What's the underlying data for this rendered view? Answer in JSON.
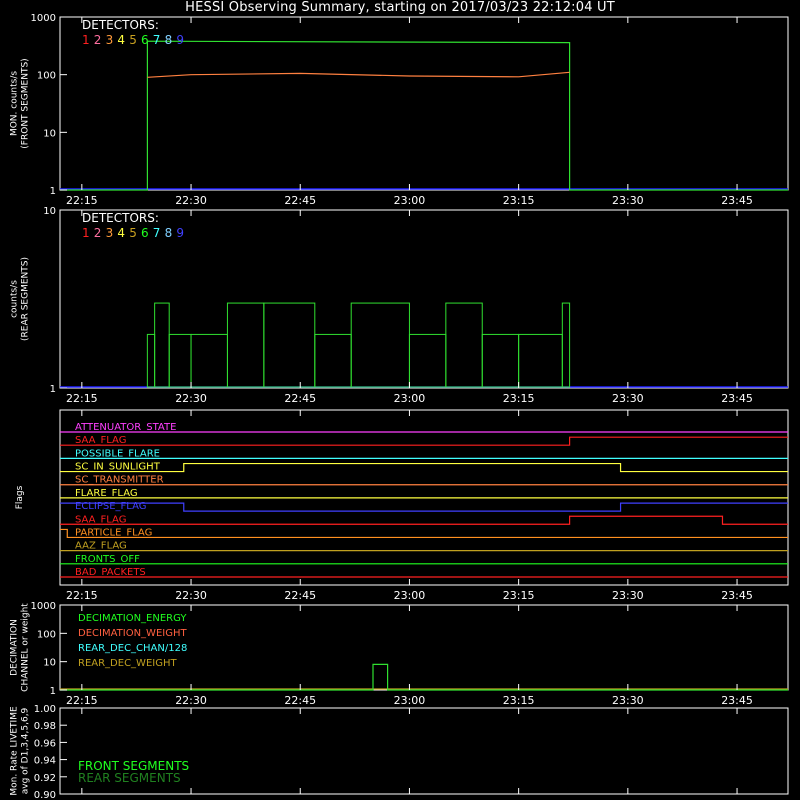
{
  "title": "HESSI Observing Summary, starting on 2017/03/23 22:12:04 UT",
  "colors": {
    "background": "#000000",
    "axis": "#ffffff",
    "det": [
      "#ff2020",
      "#ff6fa0",
      "#ff9a3a",
      "#ffff40",
      "#c8a020",
      "#20ff20",
      "#40ffff",
      "#80d0ff",
      "#4040ff"
    ],
    "front_main": "#30e030",
    "front_secondary": "#ff8040",
    "blue": "#2020ff"
  },
  "time_ticks": [
    "22:15",
    "22:30",
    "22:45",
    "23:00",
    "23:15",
    "23:30",
    "23:45"
  ],
  "chart_data": [
    {
      "id": "front",
      "type": "line",
      "ylabel": [
        "MON. counts/s",
        "(FRONT SEGMENTS)"
      ],
      "yscale": "log",
      "ylim": [
        1,
        1000
      ],
      "yticks": [
        "1",
        "10",
        "100",
        "1000"
      ],
      "legend_title": "DETECTORS:",
      "legend_items": [
        "1",
        "2",
        "3",
        "4",
        "5",
        "6",
        "7",
        "8",
        "9"
      ],
      "series": [
        {
          "color_key": "front_main",
          "x": [
            "22:12",
            "22:24",
            "22:24",
            "23:22",
            "23:22",
            "23:52"
          ],
          "y": [
            1,
            1,
            380,
            360,
            1,
            1
          ]
        },
        {
          "color_key": "front_secondary",
          "x": [
            "22:24",
            "22:30",
            "22:45",
            "23:00",
            "23:15",
            "23:22"
          ],
          "y": [
            90,
            100,
            105,
            95,
            92,
            110
          ]
        }
      ]
    },
    {
      "id": "rear",
      "type": "line",
      "ylabel": [
        "counts/s",
        "(REAR SEGMENTS)"
      ],
      "yscale": "log",
      "ylim": [
        1,
        10
      ],
      "yticks": [
        "1",
        "10"
      ],
      "legend_title": "DETECTORS:",
      "legend_items": [
        "1",
        "2",
        "3",
        "4",
        "5",
        "6",
        "7",
        "8",
        "9"
      ],
      "series": [
        {
          "color_key": "front_main",
          "x": [
            "22:24",
            "22:25",
            "22:27",
            "22:30",
            "22:35",
            "22:40",
            "22:47",
            "22:52",
            "23:00",
            "23:05",
            "23:10",
            "23:15",
            "23:21",
            "23:22"
          ],
          "y": [
            2,
            3,
            2,
            2,
            3,
            3,
            2,
            3,
            2,
            3,
            2,
            2,
            3,
            1
          ]
        }
      ]
    },
    {
      "id": "flags",
      "type": "line",
      "ylabel": [
        "Flags"
      ],
      "flags": [
        {
          "name": "ATTENUATOR_STATE",
          "color": "#ff40ff",
          "steps": [
            [
              "22:12",
              0
            ]
          ]
        },
        {
          "name": "SAA_FLAG",
          "color": "#ff2020",
          "steps": [
            [
              "22:12",
              0
            ],
            [
              "23:22",
              1
            ]
          ]
        },
        {
          "name": "POSSIBLE_FLARE",
          "color": "#40ffff",
          "steps": [
            [
              "22:12",
              0
            ]
          ]
        },
        {
          "name": "SC_IN_SUNLIGHT",
          "color": "#ffff40",
          "steps": [
            [
              "22:12",
              0
            ],
            [
              "22:29",
              1
            ],
            [
              "23:29",
              0
            ]
          ]
        },
        {
          "name": "SC_TRANSMITTER",
          "color": "#ff8040",
          "steps": [
            [
              "22:12",
              0
            ]
          ]
        },
        {
          "name": "FLARE_FLAG",
          "color": "#ffff40",
          "steps": [
            [
              "22:12",
              0
            ]
          ]
        },
        {
          "name": "ECLIPSE_FLAG",
          "color": "#4040ff",
          "steps": [
            [
              "22:12",
              1
            ],
            [
              "22:29",
              0
            ],
            [
              "23:29",
              1
            ]
          ]
        },
        {
          "name": "SAA_FLAG",
          "color": "#ff2020",
          "steps": [
            [
              "22:12",
              0
            ],
            [
              "23:22",
              1
            ],
            [
              "23:43",
              0
            ]
          ]
        },
        {
          "name": "PARTICLE_FLAG",
          "color": "#ff9020",
          "steps": [
            [
              "22:12",
              1
            ],
            [
              "22:13",
              0
            ]
          ]
        },
        {
          "name": "AAZ_FLAG",
          "color": "#c0a020",
          "steps": [
            [
              "22:12",
              0
            ]
          ]
        },
        {
          "name": "FRONTS_OFF",
          "color": "#20ff20",
          "steps": [
            [
              "22:12",
              0
            ]
          ]
        },
        {
          "name": "BAD_PACKETS",
          "color": "#ff2020",
          "steps": [
            [
              "22:12",
              0
            ]
          ]
        }
      ]
    },
    {
      "id": "decimation",
      "type": "line",
      "ylabel": [
        "DECIMATION",
        "CHANNEL or weight"
      ],
      "yscale": "log",
      "ylim": [
        1,
        1000
      ],
      "yticks": [
        "1",
        "10",
        "100",
        "1000"
      ],
      "legend_items": [
        {
          "label": "DECIMATION_ENERGY",
          "color": "#20ff20"
        },
        {
          "label": "DECIMATION_WEIGHT",
          "color": "#ff6040"
        },
        {
          "label": "REAR_DEC_CHAN/128",
          "color": "#40ffff"
        },
        {
          "label": "REAR_DEC_WEIGHT",
          "color": "#c0a020"
        }
      ],
      "series": [
        {
          "color_key": "front_main",
          "x": [
            "22:12",
            "22:55",
            "22:55",
            "22:57",
            "22:57",
            "23:52"
          ],
          "y": [
            1,
            1,
            8,
            8,
            1,
            1
          ]
        }
      ]
    },
    {
      "id": "livetime",
      "type": "line",
      "ylabel": [
        "Mon. Rate LIVETIME",
        "avg of D1,3,4,5,6,9"
      ],
      "ylim": [
        0.9,
        1.0
      ],
      "yticks": [
        "0.90",
        "0.92",
        "0.94",
        "0.96",
        "0.98",
        "1.00"
      ],
      "legend_items": [
        {
          "label": "FRONT SEGMENTS",
          "color": "#20ff20"
        },
        {
          "label": "REAR SEGMENTS",
          "color": "#208020"
        }
      ]
    }
  ]
}
